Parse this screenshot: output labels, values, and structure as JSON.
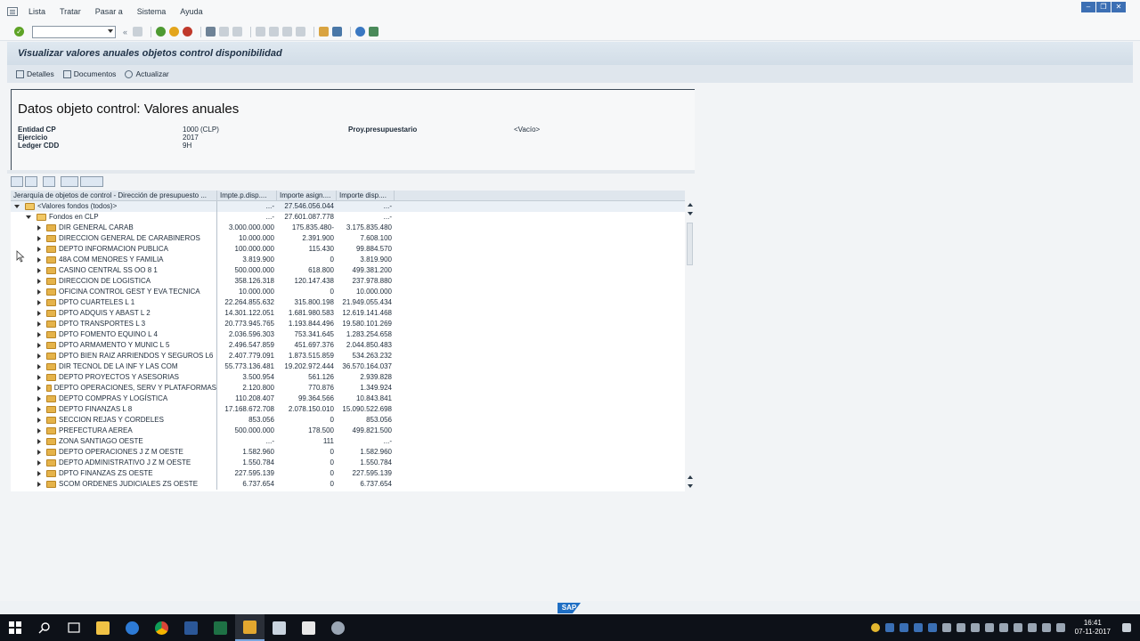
{
  "menu": [
    "Lista",
    "Tratar",
    "Pasar a",
    "Sistema",
    "Ayuda"
  ],
  "title": "Visualizar valores anuales objetos control disponibilidad",
  "app_buttons": [
    "Detalles",
    "Documentos",
    "Actualizar"
  ],
  "header": {
    "heading": "Datos objeto control: Valores anuales",
    "fields": [
      {
        "label": "Entidad CP",
        "value": "1000 (CLP)"
      },
      {
        "label": "Ejercicio",
        "value": "2017"
      },
      {
        "label": "Ledger CDD",
        "value": "9H"
      }
    ],
    "proy_label": "Proy.presupuestario",
    "proy_value": "<Vacío>"
  },
  "table": {
    "columns": [
      "Jerarquía de objetos de control - Dirección de presupuesto ...",
      "Impte.p.disp....",
      "Importe asign....",
      "Importe disp...."
    ],
    "root": {
      "name": "<Valores fondos (todos)>",
      "c1": "...-",
      "c2": "27.546.056.044",
      "c3": "...-"
    },
    "group": {
      "name": "Fondos en CLP",
      "c1": "...-",
      "c2": "27.601.087.778",
      "c3": "...-"
    },
    "rows": [
      {
        "name": "DIR GENERAL CARAB",
        "c1": "3.000.000.000",
        "c2": "175.835.480-",
        "c3": "3.175.835.480"
      },
      {
        "name": "DIRECCION GENERAL DE CARABINEROS",
        "c1": "10.000.000",
        "c2": "2.391.900",
        "c3": "7.608.100"
      },
      {
        "name": "DEPTO INFORMACION PUBLICA",
        "c1": "100.000.000",
        "c2": "115.430",
        "c3": "99.884.570"
      },
      {
        "name": "48A COM MENORES Y FAMILIA",
        "c1": "3.819.900",
        "c2": "0",
        "c3": "3.819.900"
      },
      {
        "name": "CASINO CENTRAL SS OO 8 1",
        "c1": "500.000.000",
        "c2": "618.800",
        "c3": "499.381.200"
      },
      {
        "name": "DIRECCION DE LOGISTICA",
        "c1": "358.126.318",
        "c2": "120.147.438",
        "c3": "237.978.880"
      },
      {
        "name": "OFICINA CONTROL GEST Y EVA TECNICA",
        "c1": "10.000.000",
        "c2": "0",
        "c3": "10.000.000"
      },
      {
        "name": "DPTO CUARTELES L 1",
        "c1": "22.264.855.632",
        "c2": "315.800.198",
        "c3": "21.949.055.434"
      },
      {
        "name": "DPTO ADQUIS Y ABAST L 2",
        "c1": "14.301.122.051",
        "c2": "1.681.980.583",
        "c3": "12.619.141.468"
      },
      {
        "name": "DPTO TRANSPORTES L 3",
        "c1": "20.773.945.765",
        "c2": "1.193.844.496",
        "c3": "19.580.101.269"
      },
      {
        "name": "DPTO FOMENTO EQUINO L 4",
        "c1": "2.036.596.303",
        "c2": "753.341.645",
        "c3": "1.283.254.658"
      },
      {
        "name": "DPTO ARMAMENTO Y MUNIC L 5",
        "c1": "2.496.547.859",
        "c2": "451.697.376",
        "c3": "2.044.850.483"
      },
      {
        "name": "DPTO BIEN RAIZ ARRIENDOS Y SEGUROS L6",
        "c1": "2.407.779.091",
        "c2": "1.873.515.859",
        "c3": "534.263.232"
      },
      {
        "name": "DIR TECNOL DE LA INF Y LAS COM",
        "c1": "55.773.136.481",
        "c2": "19.202.972.444",
        "c3": "36.570.164.037"
      },
      {
        "name": "DEPTO PROYECTOS Y ASESORIAS",
        "c1": "3.500.954",
        "c2": "561.126",
        "c3": "2.939.828"
      },
      {
        "name": "DEPTO OPERACIONES, SERV Y PLATAFORMAS",
        "c1": "2.120.800",
        "c2": "770.876",
        "c3": "1.349.924"
      },
      {
        "name": "DEPTO COMPRAS Y LOGÍSTICA",
        "c1": "110.208.407",
        "c2": "99.364.566",
        "c3": "10.843.841"
      },
      {
        "name": "DEPTO FINANZAS L 8",
        "c1": "17.168.672.708",
        "c2": "2.078.150.010",
        "c3": "15.090.522.698"
      },
      {
        "name": "SECCION REJAS Y CORDELES",
        "c1": "853.056",
        "c2": "0",
        "c3": "853.056"
      },
      {
        "name": "PREFECTURA AEREA",
        "c1": "500.000.000",
        "c2": "178.500",
        "c3": "499.821.500"
      },
      {
        "name": "ZONA SANTIAGO OESTE",
        "c1": "...-",
        "c2": "111",
        "c3": "...-"
      },
      {
        "name": "DEPTO OPERACIONES J Z M OESTE",
        "c1": "1.582.960",
        "c2": "0",
        "c3": "1.582.960"
      },
      {
        "name": "DEPTO ADMINISTRATIVO J Z M OESTE",
        "c1": "1.550.784",
        "c2": "0",
        "c3": "1.550.784"
      },
      {
        "name": "DPTO FINANZAS ZS OESTE",
        "c1": "227.595.139",
        "c2": "0",
        "c3": "227.595.139"
      },
      {
        "name": "SCOM ORDENES JUDICIALES ZS OESTE",
        "c1": "6.737.654",
        "c2": "0",
        "c3": "6.737.654"
      }
    ]
  },
  "status": {
    "logo": "SAP"
  },
  "clock": {
    "time": "16:41",
    "date": "07-11-2017"
  }
}
